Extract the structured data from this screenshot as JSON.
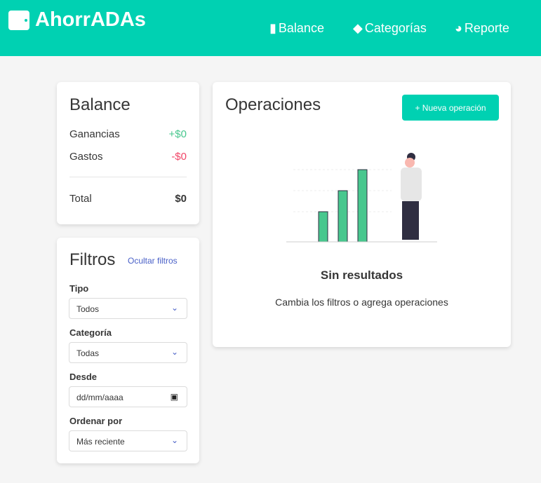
{
  "nav": {
    "brand": "AhorrADAs",
    "items": [
      {
        "label": "Balance",
        "icon": "chart-bar-icon"
      },
      {
        "label": "Categorías",
        "icon": "tag-icon"
      },
      {
        "label": "Reporte",
        "icon": "chart-pie-icon"
      }
    ]
  },
  "balance": {
    "title": "Balance",
    "ganancias_label": "Ganancias",
    "ganancias": "+$0",
    "gastos_label": "Gastos",
    "gastos": "-$0",
    "total_label": "Total",
    "total": "$0",
    "colors": {
      "ganancias": "#48c78e",
      "gastos": "#f14668"
    }
  },
  "filters": {
    "title": "Filtros",
    "toggle": "Ocultar filtros",
    "tipo_label": "Tipo",
    "tipo": "Todos",
    "categoria_label": "Categoría",
    "categoria": "Todas",
    "desde_label": "Desde",
    "desde_placeholder": "dd/mm/aaaa",
    "orden_label": "Ordenar por",
    "orden": "Más reciente"
  },
  "ops": {
    "title": "Operaciones",
    "new_button": "+ Nueva operación",
    "empty_title": "Sin resultados",
    "empty_text": "Cambia los filtros o agrega operaciones"
  }
}
